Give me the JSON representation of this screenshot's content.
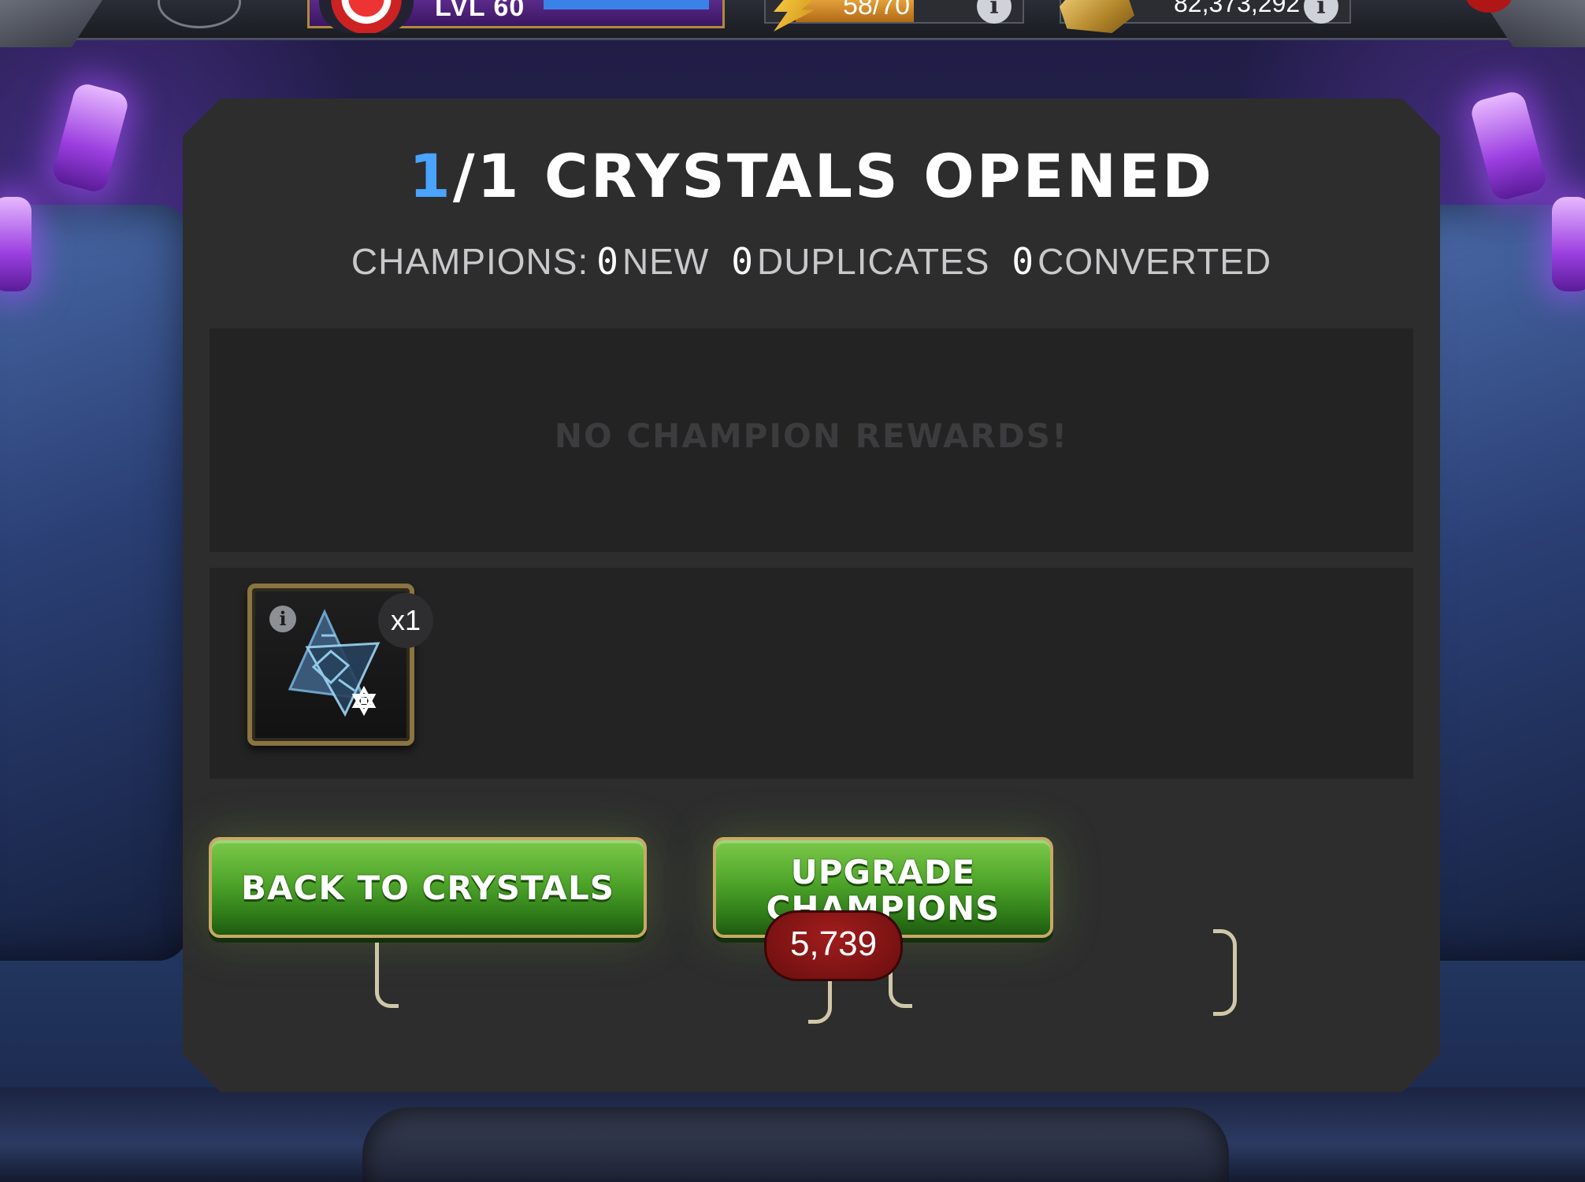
{
  "hud": {
    "level_label": "LVL 60",
    "energy_value": "58/70",
    "gold_value": "82,373,292",
    "info_glyph": "i"
  },
  "panel": {
    "title_current": "1",
    "title_rest": "/1 CRYSTALS OPENED",
    "summary": {
      "prefix": "CHAMPIONS:",
      "new_count": "0",
      "new_label": "NEW",
      "duplicates_count": "0",
      "duplicates_label": "DUPLICATES",
      "converted_count": "0",
      "converted_label": "CONVERTED"
    },
    "no_rewards_text": "NO CHAMPION REWARDS!",
    "items": [
      {
        "icon": "crystal-shard-icon",
        "info_glyph": "i",
        "count": "x1"
      }
    ]
  },
  "buttons": {
    "back_label": "BACK TO CRYSTALS",
    "back_badge": "5,739",
    "upgrade_label_line1": "UPGRADE",
    "upgrade_label_line2": "CHAMPIONS"
  },
  "colors": {
    "accent_blue": "#4aa3ff",
    "button_green": "#4ea52a",
    "badge_red": "#8a1414",
    "panel_bg": "#2d2d2e"
  }
}
